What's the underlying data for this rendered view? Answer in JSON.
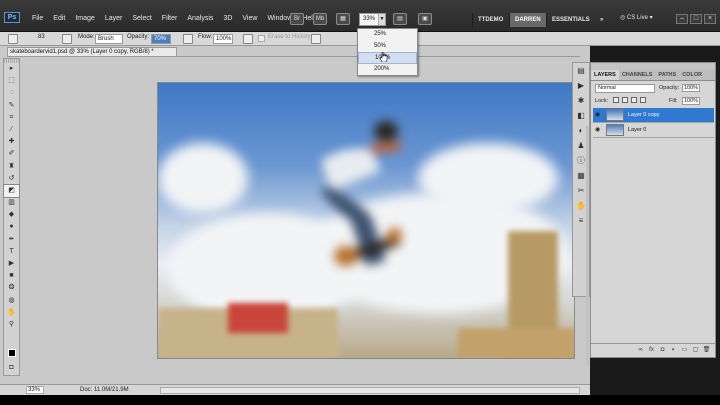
{
  "menubar": {
    "logo": "Ps",
    "items": [
      "File",
      "Edit",
      "Image",
      "Layer",
      "Select",
      "Filter",
      "Analysis",
      "3D",
      "View",
      "Window",
      "Help"
    ],
    "zoom_value": "33%",
    "workspaces": [
      "TTDEMO",
      "DARREN",
      "ESSENTIALS"
    ],
    "active_workspace": "DARREN",
    "more": "»",
    "cslive": "CS Live",
    "window_controls": [
      "–",
      "□",
      "×"
    ]
  },
  "zoom_dropdown": {
    "options": [
      "25%",
      "50%",
      "100%",
      "200%"
    ],
    "hovered": "100%"
  },
  "options_bar": {
    "mode_label": "Mode:",
    "mode_value": "Brush",
    "opacity_label": "Opacity:",
    "opacity_value": "70%",
    "flow_label": "Flow:",
    "flow_value": "100%",
    "erase_history_label": "Erase to History",
    "brush_size": "83"
  },
  "document": {
    "tab_title": "skateboardervid1.psd @ 33% (Layer 0 copy, RGB/8) *"
  },
  "statusbar": {
    "zoom": "33%",
    "doc_info": "Doc: 11.0M/21.9M"
  },
  "layers_panel": {
    "tabs": [
      "LAYERS",
      "CHANNELS",
      "PATHS",
      "COLOR"
    ],
    "active_tab": "LAYERS",
    "blend_mode": "Normal",
    "opacity_label": "Opacity:",
    "opacity_value": "100%",
    "lock_label": "Lock:",
    "fill_label": "Fill:",
    "fill_value": "100%",
    "layers": [
      {
        "name": "Layer 0 copy",
        "selected": true
      },
      {
        "name": "Layer 0",
        "selected": false
      }
    ]
  },
  "colors": {
    "selection_blue": "#2f79d2",
    "active_workspace_bg": "#6a6a6a",
    "opacity_highlight": "#4d7ebd"
  }
}
